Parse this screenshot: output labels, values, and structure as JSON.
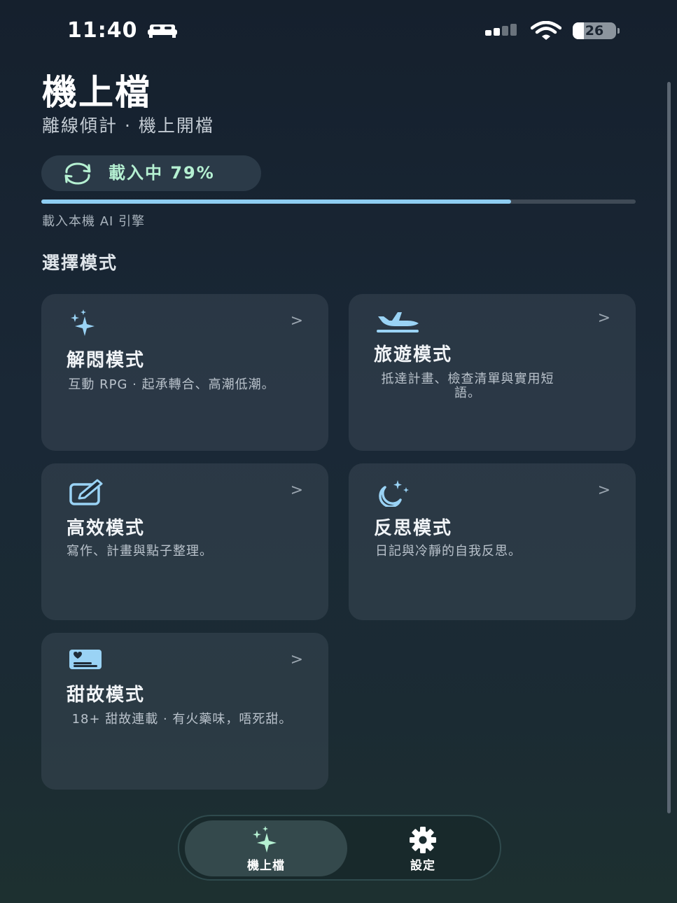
{
  "status_bar": {
    "time": "11:40",
    "battery_level": 26,
    "battery_text": "26"
  },
  "header": {
    "title": "機上檔",
    "subtitle": "離線傾計 · 機上開檔"
  },
  "loading": {
    "label": "載入中 79%",
    "progress_percent": 79,
    "caption": "載入本機 AI 引擎"
  },
  "section": {
    "title": "選擇模式"
  },
  "modes": [
    {
      "icon": "sparkles-icon",
      "title": "解悶模式",
      "description": "互動 RPG · 起承轉合、高潮低潮。",
      "chevron": ">"
    },
    {
      "icon": "airplane-icon",
      "title": "旅遊模式",
      "description": "抵達計畫、檢查清單與實用短語。",
      "chevron": ">"
    },
    {
      "icon": "edit-icon",
      "title": "高效模式",
      "description": "寫作、計畫與點子整理。",
      "chevron": ">"
    },
    {
      "icon": "moon-stars-icon",
      "title": "反思模式",
      "description": "日記與冷靜的自我反思。",
      "chevron": ">"
    },
    {
      "icon": "heart-card-icon",
      "title": "甜故模式",
      "description": "18+ 甜故連載 · 有火藥味，唔死甜。",
      "chevron": ">"
    }
  ],
  "tabs": [
    {
      "icon": "sparkles-icon",
      "label": "機上檔",
      "active": true
    },
    {
      "icon": "gear-icon",
      "label": "設定",
      "active": false
    }
  ],
  "colors": {
    "accent_green": "#b5f0d2",
    "progress_blue": "#8ecdf2",
    "icon_blue": "#9ad3f5"
  }
}
